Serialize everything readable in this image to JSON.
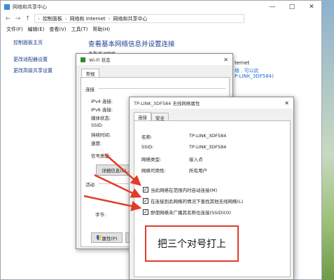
{
  "window": {
    "title": "网络和共享中心",
    "controls": {
      "minimize": "—",
      "maximize": "□",
      "close": "✕"
    }
  },
  "address": {
    "back": "←",
    "forward": "→",
    "up": "↑",
    "crumbs": [
      "控制面板",
      "网络和 Internet",
      "网络和共享中心"
    ],
    "separator": "›"
  },
  "menu": [
    "文件(F)",
    "编辑(E)",
    "查看(V)",
    "工具(T)",
    "帮助(H)"
  ],
  "sidebar": {
    "home": "控制面板主页",
    "items": [
      "更改适配器设置",
      "更改高级共享设置"
    ]
  },
  "main": {
    "heading": "查看基本网络信息并设置连接",
    "subheading": "查看活动网络",
    "conn_title": "ternet",
    "conn_status": "络 , 可以此",
    "conn_ssid": "P-LINK_3DF584)"
  },
  "wifi_status": {
    "title": "Wi-Fi 状态",
    "close": "✕",
    "tab": "常规",
    "group_connection": "连接",
    "rows": [
      "IPv4 连接:",
      "IPv6 连接:",
      "媒体状态:",
      "SSID:",
      "持续时间:",
      "速度:"
    ],
    "signal_label": "信号质量:",
    "details_button": "详细信息(E)...",
    "group_activity": "活动",
    "bytes_label": "字节:",
    "properties_button": "属性(P)"
  },
  "properties": {
    "title": "TP-LINK_3DF584 无线网络属性",
    "close": "✕",
    "tabs": [
      "连接",
      "安全"
    ],
    "fields": [
      {
        "label": "名称:",
        "value": "TP-LINK_3DF584"
      },
      {
        "label": "SSID:",
        "value": "TP-LINK_3DF584"
      },
      {
        "label": "网络类型:",
        "value": "接入点"
      },
      {
        "label": "网络可用性:",
        "value": "所有用户"
      }
    ],
    "checkboxes": [
      {
        "label": "当此网络在范围内时自动连接(M)",
        "checked": true,
        "mark": "✓"
      },
      {
        "label": "在连接到此网络的情况下查找其他无线网络(L)",
        "checked": true,
        "mark": "✓"
      },
      {
        "label": "即使网络未广播其名称也连接(SSID)(O)",
        "checked": true,
        "mark": "✓"
      }
    ]
  },
  "annotation": {
    "text": "把三个对号打上",
    "border_color": "#e23b2a"
  },
  "arrow_color": "#e23b2a"
}
